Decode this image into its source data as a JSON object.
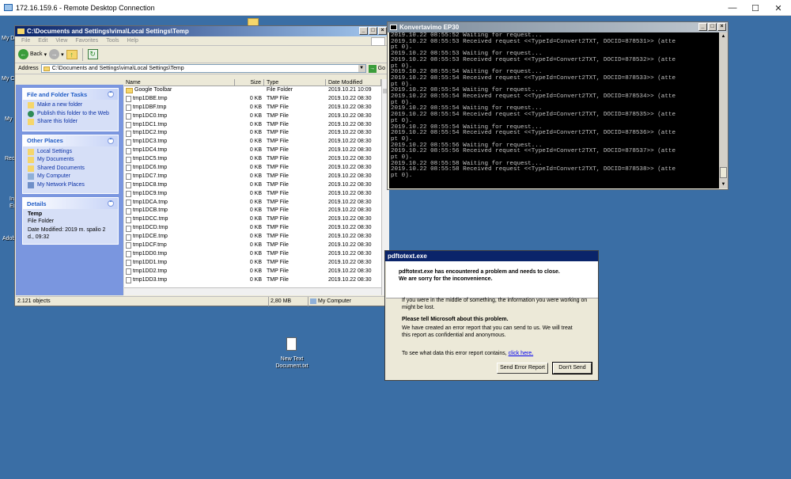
{
  "rdp": {
    "title": "172.16.159.6 - Remote Desktop Connection",
    "min": "—",
    "max": "☐",
    "close": "✕"
  },
  "desktop": {
    "left_labels": [
      "My D",
      "My C",
      "My",
      "Recy",
      "Int",
      "Ex",
      "Adob"
    ],
    "text_doc_label": "New Text Document.txt"
  },
  "explorer": {
    "title": "C:\\Documents and Settings\\vima\\Local Settings\\Temp",
    "menu": [
      "File",
      "Edit",
      "View",
      "Favorites",
      "Tools",
      "Help"
    ],
    "back_label": "Back",
    "address_label": "Address",
    "address_value": "C:\\Documents and Settings\\vima\\Local Settings\\Temp",
    "go_label": "Go",
    "panels": {
      "tasks": {
        "title": "File and Folder Tasks",
        "items": [
          "Make a new folder",
          "Publish this folder to the Web",
          "Share this folder"
        ]
      },
      "places": {
        "title": "Other Places",
        "items": [
          "Local Settings",
          "My Documents",
          "Shared Documents",
          "My Computer",
          "My Network Places"
        ]
      },
      "details": {
        "title": "Details",
        "name": "Temp",
        "type": "File Folder",
        "modified": "Date Modified: 2019 m. spalio 2 d., 09:32"
      }
    },
    "columns": [
      "Name",
      "Size",
      "Type",
      "Date Modified"
    ],
    "files": [
      {
        "name": "Google Toolbar",
        "size": "",
        "type": "File Folder",
        "date": "2019.10.21 10:09"
      },
      {
        "name": "tmp1DBE.tmp",
        "size": "0 KB",
        "type": "TMP File",
        "date": "2019.10.22 08:30"
      },
      {
        "name": "tmp1DBF.tmp",
        "size": "0 KB",
        "type": "TMP File",
        "date": "2019.10.22 08:30"
      },
      {
        "name": "tmp1DC0.tmp",
        "size": "0 KB",
        "type": "TMP File",
        "date": "2019.10.22 08:30"
      },
      {
        "name": "tmp1DC1.tmp",
        "size": "0 KB",
        "type": "TMP File",
        "date": "2019.10.22 08:30"
      },
      {
        "name": "tmp1DC2.tmp",
        "size": "0 KB",
        "type": "TMP File",
        "date": "2019.10.22 08:30"
      },
      {
        "name": "tmp1DC3.tmp",
        "size": "0 KB",
        "type": "TMP File",
        "date": "2019.10.22 08:30"
      },
      {
        "name": "tmp1DC4.tmp",
        "size": "0 KB",
        "type": "TMP File",
        "date": "2019.10.22 08:30"
      },
      {
        "name": "tmp1DC5.tmp",
        "size": "0 KB",
        "type": "TMP File",
        "date": "2019.10.22 08:30"
      },
      {
        "name": "tmp1DC6.tmp",
        "size": "0 KB",
        "type": "TMP File",
        "date": "2019.10.22 08:30"
      },
      {
        "name": "tmp1DC7.tmp",
        "size": "0 KB",
        "type": "TMP File",
        "date": "2019.10.22 08:30"
      },
      {
        "name": "tmp1DC8.tmp",
        "size": "0 KB",
        "type": "TMP File",
        "date": "2019.10.22 08:30"
      },
      {
        "name": "tmp1DC9.tmp",
        "size": "0 KB",
        "type": "TMP File",
        "date": "2019.10.22 08:30"
      },
      {
        "name": "tmp1DCA.tmp",
        "size": "0 KB",
        "type": "TMP File",
        "date": "2019.10.22 08:30"
      },
      {
        "name": "tmp1DCB.tmp",
        "size": "0 KB",
        "type": "TMP File",
        "date": "2019.10.22 08:30"
      },
      {
        "name": "tmp1DCC.tmp",
        "size": "0 KB",
        "type": "TMP File",
        "date": "2019.10.22 08:30"
      },
      {
        "name": "tmp1DCD.tmp",
        "size": "0 KB",
        "type": "TMP File",
        "date": "2019.10.22 08:30"
      },
      {
        "name": "tmp1DCE.tmp",
        "size": "0 KB",
        "type": "TMP File",
        "date": "2019.10.22 08:30"
      },
      {
        "name": "tmp1DCF.tmp",
        "size": "0 KB",
        "type": "TMP File",
        "date": "2019.10.22 08:30"
      },
      {
        "name": "tmp1DD0.tmp",
        "size": "0 KB",
        "type": "TMP File",
        "date": "2019.10.22 08:30"
      },
      {
        "name": "tmp1DD1.tmp",
        "size": "0 KB",
        "type": "TMP File",
        "date": "2019.10.22 08:30"
      },
      {
        "name": "tmp1DD2.tmp",
        "size": "0 KB",
        "type": "TMP File",
        "date": "2019.10.22 08:30"
      },
      {
        "name": "tmp1DD3.tmp",
        "size": "0 KB",
        "type": "TMP File",
        "date": "2019.10.22 08:30"
      }
    ],
    "status": {
      "objects": "2.121 objects",
      "size": "2,80 MB",
      "location": "My Computer"
    }
  },
  "console": {
    "title": "Konvertavimo EP30",
    "lines": [
      "2019.10.22 08:55:52 Waiting for request...",
      "2019.10.22 08:55:53 Received request <<TypeId=Convert2TXT, DOCID=878531>> (atte",
      "pt 0).",
      "2019.10.22 08:55:53 Waiting for request...",
      "2019.10.22 08:55:53 Received request <<TypeId=Convert2TXT, DOCID=878532>> (atte",
      "pt 0).",
      "2019.10.22 08:55:54 Waiting for request...",
      "2019.10.22 08:55:54 Received request <<TypeId=Convert2TXT, DOCID=878533>> (atte",
      "pt 0).",
      "2019.10.22 08:55:54 Waiting for request...",
      "2019.10.22 08:55:54 Received request <<TypeId=Convert2TXT, DOCID=878534>> (atte",
      "pt 0).",
      "2019.10.22 08:55:54 Waiting for request...",
      "2019.10.22 08:55:54 Received request <<TypeId=Convert2TXT, DOCID=878535>> (atte",
      "pt 0).",
      "2019.10.22 08:55:54 Waiting for request...",
      "2019.10.22 08:55:54 Received request <<TypeId=Convert2TXT, DOCID=878536>> (atte",
      "pt 0).",
      "2019.10.22 08:55:56 Waiting for request...",
      "2019.10.22 08:55:56 Received request <<TypeId=Convert2TXT, DOCID=878537>> (atte",
      "pt 0).",
      "2019.10.22 08:55:58 Waiting for request...",
      "2019.10.22 08:55:58 Received request <<TypeId=Convert2TXT, DOCID=878538>> (atte",
      "pt 0)."
    ]
  },
  "error": {
    "title": "pdftotext.exe",
    "headline": "pdftotext.exe has encountered a problem and needs to close.  We are sorry for the inconvenience.",
    "para1": "If you were in the middle of something, the information you were working on might be lost.",
    "tell_title": "Please tell Microsoft about this problem.",
    "para2": "We have created an error report that you can send to us.  We will treat this report as confidential and anonymous.",
    "see_text": "To see what data this error report contains, ",
    "link": "click here.",
    "send_button": "Send Error Report",
    "dont_send_button": "Don't Send"
  },
  "colors": {
    "desktop": "#3a6ea5",
    "title_active": "#0a246a",
    "taskpane": "#7a96df"
  }
}
